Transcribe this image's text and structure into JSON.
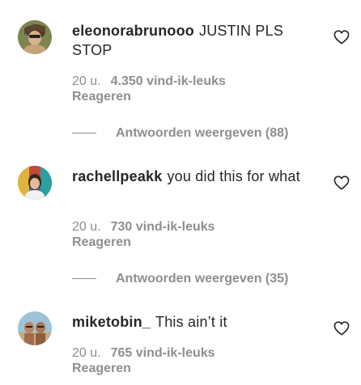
{
  "comments": [
    {
      "username": "eleonorabrunooo",
      "text": "JUSTIN PLS STOP",
      "time": "20 u.",
      "likes": "4.350 vind-ik-leuks",
      "reply_label": "Reageren",
      "view_replies": "Antwoorden weergeven (88)"
    },
    {
      "username": "rachellpeakk",
      "text": "you did this for what",
      "time": "20 u.",
      "likes": "730 vind-ik-leuks",
      "reply_label": "Reageren",
      "view_replies": "Antwoorden weergeven (35)"
    },
    {
      "username": "miketobin_",
      "text": "This ain’t it",
      "time": "20 u.",
      "likes": "765 vind-ik-leuks",
      "reply_label": "Reageren"
    }
  ],
  "icons": {
    "like": "heart-outline-icon",
    "avatar": "profile-photo"
  },
  "colors": {
    "text": "#262626",
    "secondary": "#8e8e8e",
    "background": "#ffffff"
  }
}
